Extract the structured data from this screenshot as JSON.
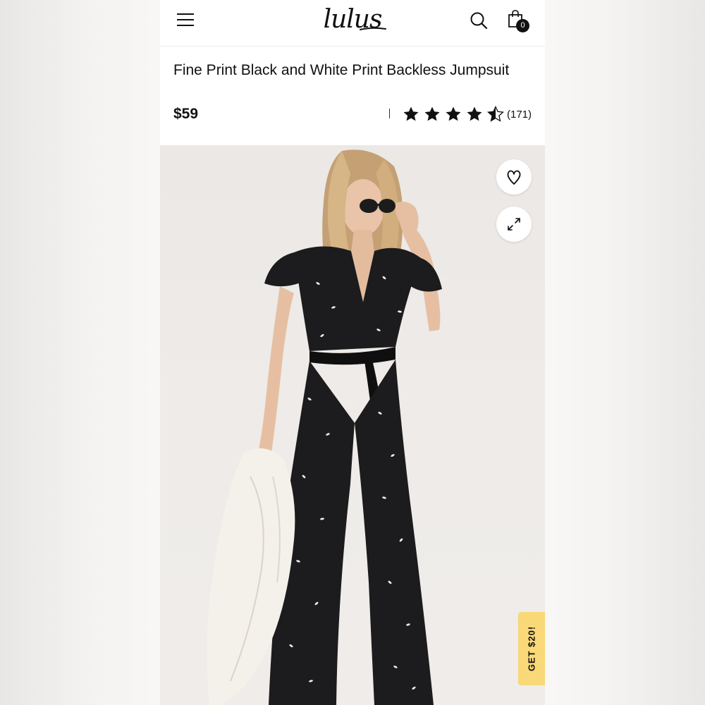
{
  "header": {
    "logo": "lulus",
    "icons": {
      "menu": "hamburger-menu-icon",
      "search": "search-icon",
      "bag": "shopping-bag-icon"
    },
    "bag_count": "0"
  },
  "product": {
    "title": "Fine Print Black and White Print Backless Jumpsuit",
    "price": "$59",
    "rating": {
      "stars": 4.5,
      "max": 5,
      "review_count": "(171)"
    }
  },
  "image_actions": {
    "favorite_icon": "heart-icon",
    "expand_icon": "expand-icon"
  },
  "promo": {
    "label": "GET $20!",
    "color": "#f9d877"
  }
}
